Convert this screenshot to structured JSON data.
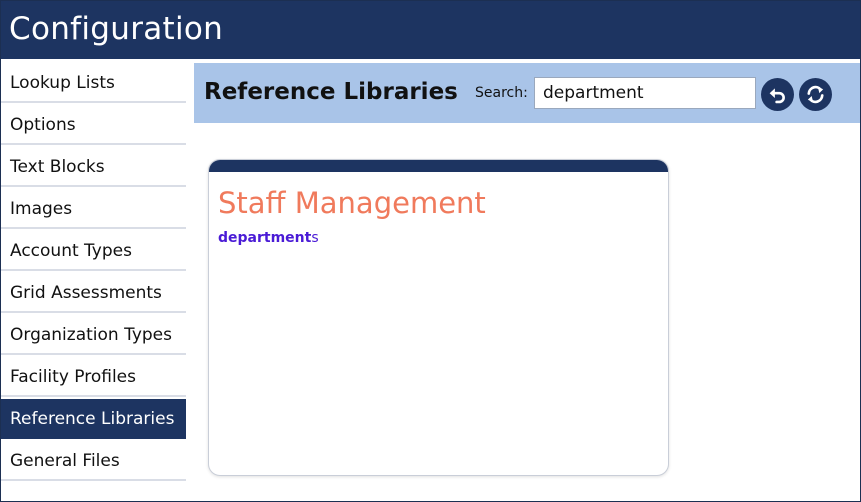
{
  "window": {
    "title": "Configuration"
  },
  "sidebar": {
    "items": [
      {
        "label": "Lookup Lists",
        "active": false
      },
      {
        "label": "Options",
        "active": false
      },
      {
        "label": "Text Blocks",
        "active": false
      },
      {
        "label": "Images",
        "active": false
      },
      {
        "label": "Account Types",
        "active": false
      },
      {
        "label": "Grid Assessments",
        "active": false
      },
      {
        "label": "Organization Types",
        "active": false
      },
      {
        "label": "Facility Profiles",
        "active": false
      },
      {
        "label": "Reference Libraries",
        "active": true
      },
      {
        "label": "General Files",
        "active": false
      }
    ]
  },
  "header": {
    "title": "Reference Libraries",
    "search_label": "Search:",
    "search_value": "department",
    "buttons": {
      "undo_icon": "undo-icon",
      "refresh_icon": "refresh-icon"
    }
  },
  "results": {
    "cards": [
      {
        "title": "Staff Management",
        "link_match": "department",
        "link_rest": "s"
      }
    ]
  },
  "colors": {
    "navy": "#1d3461",
    "header_bar": "#a9c4e8",
    "card_title": "#f07a5c",
    "link": "#4a1bd6"
  }
}
